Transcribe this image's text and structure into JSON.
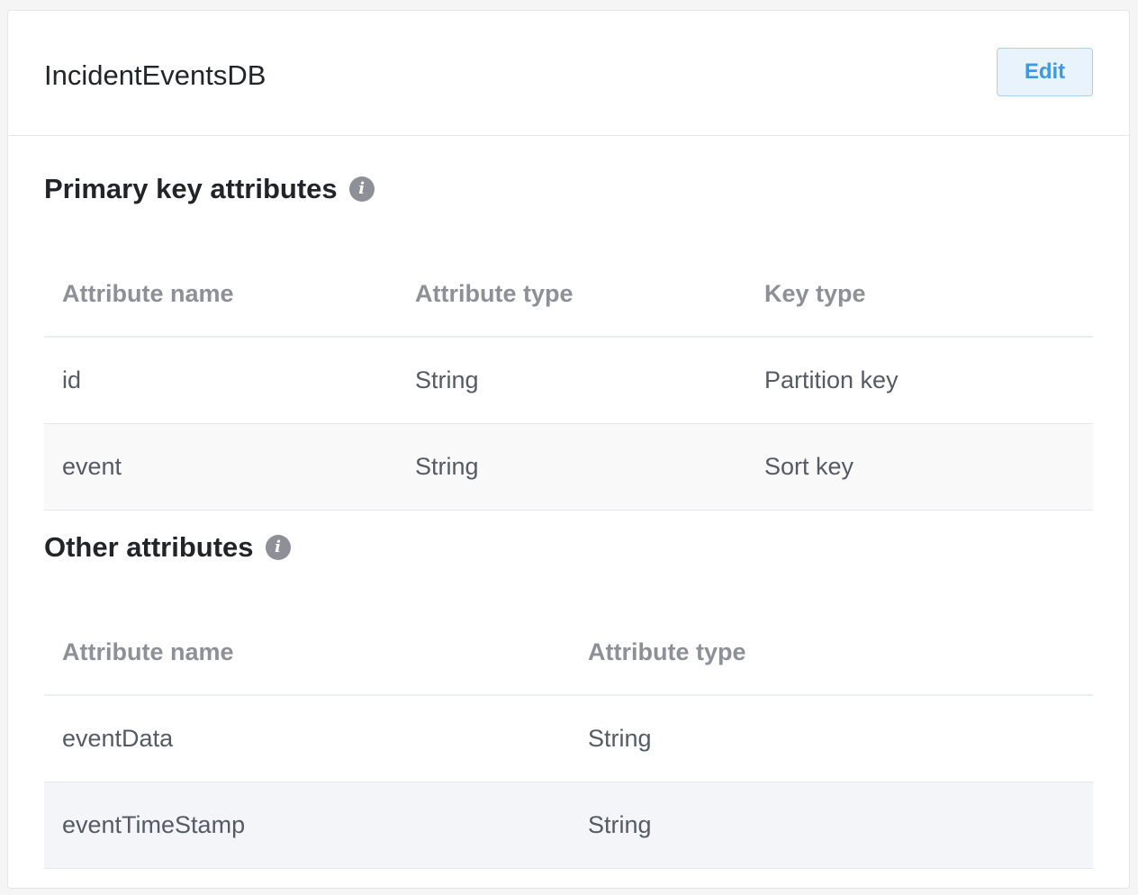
{
  "header": {
    "title": "IncidentEventsDB",
    "edit_label": "Edit"
  },
  "primary_key": {
    "title": "Primary key attributes",
    "columns": [
      "Attribute name",
      "Attribute type",
      "Key type"
    ],
    "rows": [
      [
        "id",
        "String",
        "Partition key"
      ],
      [
        "event",
        "String",
        "Sort key"
      ]
    ]
  },
  "other": {
    "title": "Other attributes",
    "columns": [
      "Attribute name",
      "Attribute type"
    ],
    "rows": [
      [
        "eventData",
        "String"
      ],
      [
        "eventTimeStamp",
        "String"
      ]
    ]
  },
  "icons": {
    "info": "info-icon"
  },
  "colors": {
    "accent": "#3d99e6",
    "header_text": "#8d9096",
    "body_text": "#545b64"
  }
}
